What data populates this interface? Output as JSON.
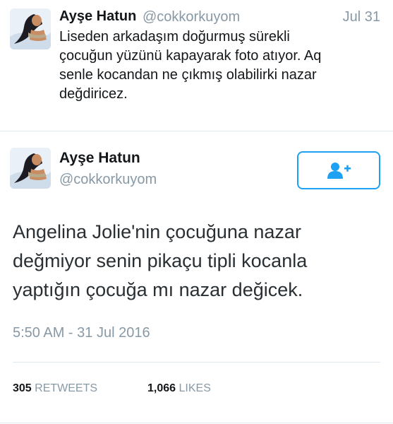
{
  "parent_tweet": {
    "name": "Ayşe Hatun",
    "handle": "@cokkorkuyom",
    "date": "Jul 31",
    "text_lines": [
      "Liseden arkadaşım doğurmuş sürekli",
      "çocuğun yüzünü kapayarak foto atıyor. Aq",
      "senle kocandan ne çıkmış olabilirki nazar",
      "değdiricez."
    ]
  },
  "main_tweet": {
    "name": "Ayşe Hatun",
    "handle": "@cokkorkuyom",
    "follow_icon": "add-user-icon",
    "text_lines": [
      "Angelina Jolie'nin çocuğuna nazar",
      "değmiyor senin pikaçu tipli kocanla",
      "yaptığın çocuğa mı nazar değicek."
    ],
    "timestamp": "5:50 AM - 31 Jul 2016",
    "retweets_count": "305",
    "retweets_label": "RETWEETS",
    "likes_count": "1,066",
    "likes_label": "LIKES"
  },
  "colors": {
    "accent": "#1da1f2",
    "secondary_text": "#8899a6",
    "divider": "#e1e8ed"
  }
}
